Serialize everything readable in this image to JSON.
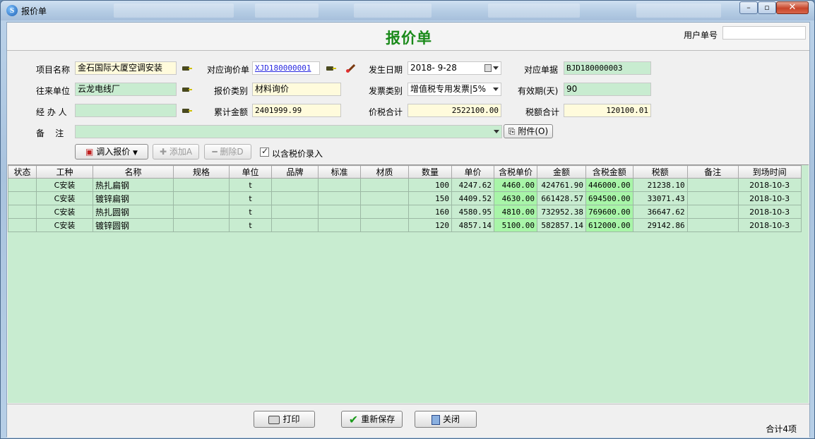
{
  "window": {
    "title": "报价单",
    "app_icon_letter": "S",
    "min_glyph": "–",
    "max_glyph": "▫",
    "close_glyph": "✕"
  },
  "header": {
    "title": "报价单",
    "user_no_label": "用户单号",
    "user_no_value": ""
  },
  "form": {
    "project_name_label": "项目名称",
    "project_name_value": "金石国际大厦空调安装",
    "inquiry_label": "对应询价单",
    "inquiry_value": "XJD180000001",
    "date_label": "发生日期",
    "date_value": "2018- 9-28",
    "bill_label": "对应单据",
    "bill_value": "BJD180000003",
    "partner_label": "往来单位",
    "partner_value": "云龙电线厂",
    "quote_type_label": "报价类别",
    "quote_type_value": "材料询价",
    "invoice_type_label": "发票类别",
    "invoice_type_value": "增值税专用发票|5%",
    "valid_label": "有效期(天)",
    "valid_value": "90",
    "handler_label": "经 办 人",
    "handler_value": "",
    "total_amount_label": "累计金额",
    "total_amount_value": "2401999.99",
    "price_tax_label": "价税合计",
    "price_tax_value": "2522100.00",
    "tax_total_label": "税额合计",
    "tax_total_value": "120100.01",
    "remark_label": "备    注",
    "remark_value": "",
    "attach_label": "附件(O)"
  },
  "toolbar": {
    "load_quote": "调入报价",
    "add": "添加A",
    "delete": "删除D",
    "tax_included": "以含税价录入"
  },
  "table": {
    "columns": [
      "状态",
      "工种",
      "名称",
      "规格",
      "单位",
      "品牌",
      "标准",
      "材质",
      "数量",
      "单价",
      "含税单价",
      "金额",
      "含税金额",
      "税额",
      "备注",
      "到场时间"
    ],
    "rows": [
      [
        "",
        "C安装",
        "热扎扁钢",
        "",
        "t",
        "",
        "",
        "",
        "100",
        "4247.62",
        "4460.00",
        "424761.90",
        "446000.00",
        "21238.10",
        "",
        "2018-10-3"
      ],
      [
        "",
        "C安装",
        "镀锌扁钢",
        "",
        "t",
        "",
        "",
        "",
        "150",
        "4409.52",
        "4630.00",
        "661428.57",
        "694500.00",
        "33071.43",
        "",
        "2018-10-3"
      ],
      [
        "",
        "C安装",
        "热扎圆钢",
        "",
        "t",
        "",
        "",
        "",
        "160",
        "4580.95",
        "4810.00",
        "732952.38",
        "769600.00",
        "36647.62",
        "",
        "2018-10-3"
      ],
      [
        "",
        "C安装",
        "镀锌圆钢",
        "",
        "t",
        "",
        "",
        "",
        "120",
        "4857.14",
        "5100.00",
        "582857.14",
        "612000.00",
        "29142.86",
        "",
        "2018-10-3"
      ]
    ]
  },
  "footer": {
    "print": "打印",
    "resave": "重新保存",
    "close": "关闭",
    "total": "合计4项"
  }
}
